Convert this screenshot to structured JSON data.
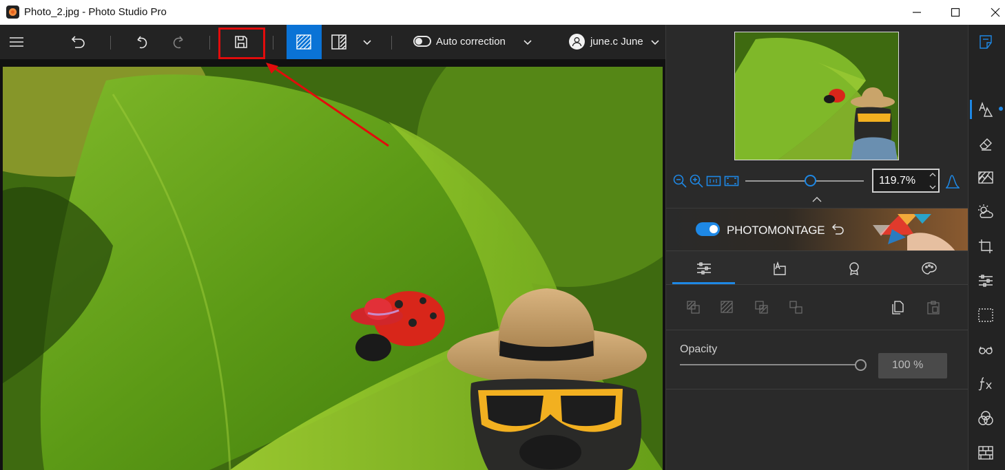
{
  "window": {
    "title": "Photo_2.jpg - Photo Studio Pro",
    "minimize_icon": "minimize-icon",
    "maximize_icon": "maximize-icon",
    "close_icon": "close-icon"
  },
  "toolbar": {
    "menu_icon": "hamburger-menu-icon",
    "back_icon": "back-arrow-icon",
    "undo_icon": "undo-icon",
    "redo_icon": "redo-icon",
    "save_icon": "floppy-disk-icon",
    "view_single_icon": "single-view-icon",
    "view_compare_icon": "split-view-icon",
    "auto_correction_label": "Auto correction",
    "user_label": "june.c June"
  },
  "navigator": {
    "zoom_value": "119.7%",
    "zoom_level": 0.55
  },
  "photomontage": {
    "label": "PHOTOMONTAGE",
    "enabled": true
  },
  "tabs": [
    {
      "name": "adjustments",
      "icon": "sliders-icon",
      "active": true
    },
    {
      "name": "text",
      "icon": "text-frame-icon",
      "active": false
    },
    {
      "name": "award",
      "icon": "badge-icon",
      "active": false
    },
    {
      "name": "effects",
      "icon": "palette-icon",
      "active": false
    }
  ],
  "layer_tools": [
    "arrange-front-icon",
    "arrange-forward-icon",
    "arrange-backward-icon",
    "arrange-back-icon",
    "copy-icon",
    "paste-icon"
  ],
  "opacity": {
    "label": "Opacity",
    "value": "100 %",
    "level": 1.0
  },
  "colors": {
    "accent": "#1e88e5",
    "highlight": "#e20c0c",
    "panel": "#2a2a2a",
    "toolbar": "#232323"
  },
  "tool_strip": [
    "edit-icon",
    "shapes-icon",
    "eraser-icon",
    "texture-icon",
    "weather-icon",
    "crop-icon",
    "adjust-icon",
    "selection-icon",
    "glasses-icon",
    "fx-icon",
    "color-mix-icon",
    "brick-icon"
  ]
}
